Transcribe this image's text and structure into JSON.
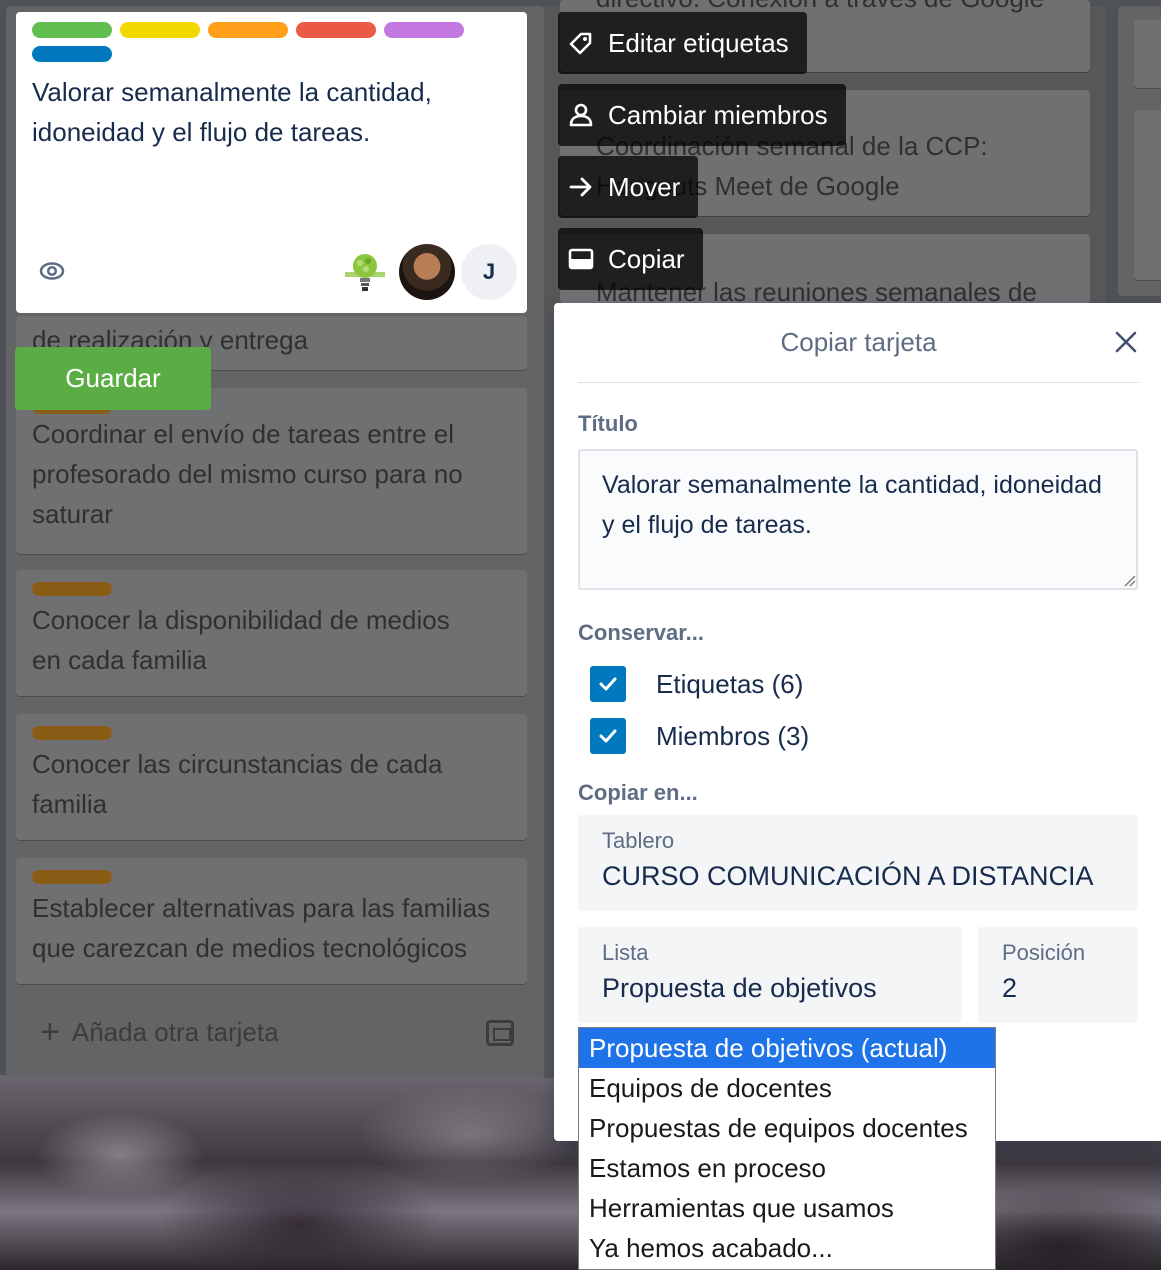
{
  "board": {
    "bg_cards": [
      {
        "label_color": "#8a5d17",
        "text": ""
      },
      {
        "text_lines": [
          "Coordinar el envío de tareas entre el",
          "profesorado del mismo curso para no",
          "saturar"
        ]
      },
      {
        "text_lines": [
          "Conocer la disponibilidad de medios",
          "en cada familia"
        ]
      },
      {
        "text_lines": [
          "Conocer las circunstancias de cada",
          "familia"
        ]
      },
      {
        "text_lines": [
          "Establecer alternativas para las familias",
          "que carezcan de medios tecnológicos"
        ]
      }
    ],
    "partial_text_1": "de realización y entrega",
    "mid_text_1": "directivo. Conexión a través de Google",
    "mid_text_2": "Coordinación semanal de la CCP:",
    "mid_text_3": "Hangouts Meet de Google",
    "mid_text_4": "Mantener las reuniones semanales de",
    "add_card_label": "Añada otra tarjeta"
  },
  "edit_card": {
    "labels": [
      {
        "color": "#61bd4f"
      },
      {
        "color": "#f2d600"
      },
      {
        "color": "#ff9f1a"
      },
      {
        "color": "#eb5a46"
      },
      {
        "color": "#c377e0"
      },
      {
        "color": "#0079bf"
      }
    ],
    "title": "Valorar semanalmente la cantidad, idoneidad y el flujo de tareas.",
    "members": [
      {
        "type": "logo",
        "icon": "lightbulb-logo"
      },
      {
        "type": "photo"
      },
      {
        "type": "initial",
        "initial": "J"
      }
    ],
    "save_label": "Guardar"
  },
  "quick_actions": [
    {
      "icon": "tag-icon",
      "label": "Editar etiquetas"
    },
    {
      "icon": "person-icon",
      "label": "Cambiar miembros"
    },
    {
      "icon": "arrow-right-icon",
      "label": "Mover"
    },
    {
      "icon": "card-icon",
      "label": "Copiar"
    }
  ],
  "copy_popover": {
    "header": "Copiar tarjeta",
    "title_label": "Título",
    "title_value": "Valorar semanalmente la cantidad, idoneidad y el flujo de tareas.",
    "keep_label": "Conservar...",
    "keep_labels": "Etiquetas (6)",
    "keep_members": "Miembros (3)",
    "copy_to_label": "Copiar en...",
    "board_caption": "Tablero",
    "board_value": "CURSO COMUNICACIÓN A DISTANCIA",
    "list_caption": "Lista",
    "list_value": "Propuesta de objetivos",
    "position_caption": "Posición",
    "position_value": "2"
  },
  "list_dropdown": {
    "options": [
      "Propuesta de objetivos (actual)",
      "Equipos de docentes",
      "Propuestas de equipos docentes",
      "Estamos en proceso",
      "Herramientas que usamos",
      "Ya hemos acabado..."
    ],
    "selected_index": 0,
    "accent": "#1e73e8"
  }
}
